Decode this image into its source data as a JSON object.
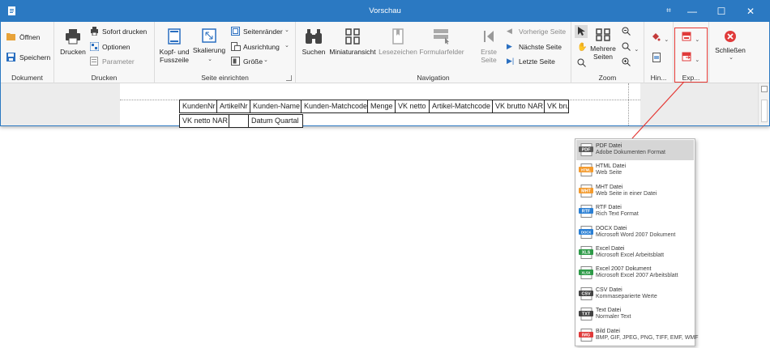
{
  "window": {
    "title": "Vorschau",
    "icons": [
      "app-icon",
      "fullscreen-icon",
      "minimize-icon",
      "maximize-icon",
      "close-icon"
    ]
  },
  "ribbon": {
    "groups": {
      "dokument": {
        "label": "Dokument",
        "open": "Öffnen",
        "save": "Speichern"
      },
      "drucken": {
        "label": "Drucken",
        "print": "Drucken",
        "quick_print": "Sofort drucken",
        "options": "Optionen",
        "parameters": "Parameter"
      },
      "seite": {
        "label": "Seite einrichten",
        "header_footer_1": "Kopf- und",
        "header_footer_2": "Fusszeile",
        "scale": "Skalierung",
        "margins": "Seitenränder",
        "orientation": "Ausrichtung",
        "size": "Größe"
      },
      "navigation": {
        "label": "Navigation",
        "search": "Suchen",
        "thumbnails": "Miniaturansicht",
        "bookmarks": "Lesezeichen",
        "form_fields": "Formularfelder",
        "first_1": "Erste",
        "first_2": "Seite",
        "prev": "Vorherige Seite",
        "next": "Nächste Seite",
        "last": "Letzte Seite"
      },
      "zoom": {
        "label": "Zoom",
        "multi_1": "Mehrere",
        "multi_2": "Seiten"
      },
      "hintergrund": {
        "label": "Hin..."
      },
      "export": {
        "label": "Exp..."
      },
      "close": {
        "label": "Schließen"
      }
    }
  },
  "document": {
    "header_row": [
      "KundenNr",
      "ArtikelNr",
      "Kunden-Name",
      "Kunden-Matchcode",
      "Menge",
      "VK netto",
      "Artikel-Matchcode",
      "VK brutto NAR",
      "VK bru"
    ],
    "second_row": [
      "VK netto NAR",
      "",
      "Datum Quartal"
    ]
  },
  "export_menu": {
    "items": [
      {
        "badge": "PDF",
        "title": "PDF Datei",
        "desc": "Adobe Dokumenten Format",
        "color": "#5a5a5a"
      },
      {
        "badge": "HTML",
        "title": "HTML Datei",
        "desc": "Web Seite",
        "color": "#f39a2d"
      },
      {
        "badge": "MHT",
        "title": "MHT Datei",
        "desc": "Web Seite in einer Datei",
        "color": "#f39a2d"
      },
      {
        "badge": "RTF",
        "title": "RTF Datei",
        "desc": "Rich Text Format",
        "color": "#2a7fd4"
      },
      {
        "badge": "DOCX",
        "title": "DOCX Datei",
        "desc": "Microsoft Word 2007 Dokument",
        "color": "#2a7fd4"
      },
      {
        "badge": "XLS",
        "title": "Excel Datei",
        "desc": "Microsoft Excel Arbeitsblatt",
        "color": "#2e9a48"
      },
      {
        "badge": "XLSX",
        "title": "Excel 2007 Dokument",
        "desc": "Microsoft Excel 2007 Arbeitsblatt",
        "color": "#2e9a48"
      },
      {
        "badge": "CSV",
        "title": "CSV Datei",
        "desc": "Kommaseparierte Werte",
        "color": "#444444"
      },
      {
        "badge": "TXT",
        "title": "Text Datei",
        "desc": "Normaler Text",
        "color": "#444444"
      },
      {
        "badge": "IMG",
        "title": "Bild Datei",
        "desc": "BMP, GIF, JPEG, PNG, TIFF, EMF, WMF",
        "color": "#e03b3b"
      }
    ]
  },
  "colors": {
    "titlebar": "#2b79c2",
    "highlight": "#e53935",
    "menu_active": "#d6d6d6"
  }
}
